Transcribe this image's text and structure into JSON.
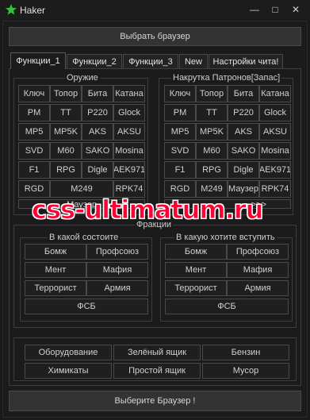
{
  "window": {
    "title": "Haker",
    "minimize_glyph": "—",
    "maximize_glyph": "□",
    "close_glyph": "✕"
  },
  "top_button": "Выбрать браузер",
  "tabs": [
    "Функции_1",
    "Функции_2",
    "Функции_3",
    "New",
    "Настройки чита!"
  ],
  "weapons_group": {
    "title": "Оружие",
    "rows": [
      [
        "Ключ",
        "Топор",
        "Бита",
        "Катана"
      ],
      [
        "PM",
        "TT",
        "P220",
        "Glock"
      ],
      [
        "MP5",
        "MP5K",
        "AKS",
        "AKSU"
      ],
      [
        "SVD",
        "M60",
        "SAKO",
        "Mosina"
      ],
      [
        "F1",
        "RPG",
        "Digle",
        "AEK971"
      ],
      [
        "RGD",
        "M249",
        "RPK74"
      ]
    ],
    "partial_button": "Маузер"
  },
  "ammo_group": {
    "title": "Накрутка Патронов[Запас]",
    "rows": [
      [
        "Ключ",
        "Топор",
        "Бита",
        "Катана"
      ],
      [
        "PM",
        "TT",
        "P220",
        "Glock"
      ],
      [
        "MP5",
        "MP5K",
        "AKS",
        "AKSU"
      ],
      [
        "SVD",
        "M60",
        "SAKO",
        "Mosina"
      ],
      [
        "F1",
        "RPG",
        "Digle",
        "AEK971"
      ],
      [
        "RGD",
        "M249",
        "Маузер",
        "RPK74"
      ]
    ],
    "partial_button": ">>>"
  },
  "factions": {
    "title": "Фракции",
    "current": {
      "title": "В какой состоите",
      "buttons": [
        "Бомж",
        "Профсоюз",
        "Мент",
        "Мафия",
        "Террорист",
        "Армия",
        "ФСБ"
      ]
    },
    "join": {
      "title": "В какую хотите вступить",
      "buttons": [
        "Бомж",
        "Профсоюз",
        "Мент",
        "Мафия",
        "Террорист",
        "Армия",
        "ФСБ"
      ]
    }
  },
  "items": [
    "Оборудование",
    "Зелёный ящик",
    "Бензин",
    "Химикаты",
    "Простой ящик",
    "Мусор"
  ],
  "bottom_button": "Выберите Браузер !",
  "watermark": "css-ultimatum.ru",
  "colors": {
    "accent_icon": "#35c23a",
    "watermark": "#ff0033"
  }
}
